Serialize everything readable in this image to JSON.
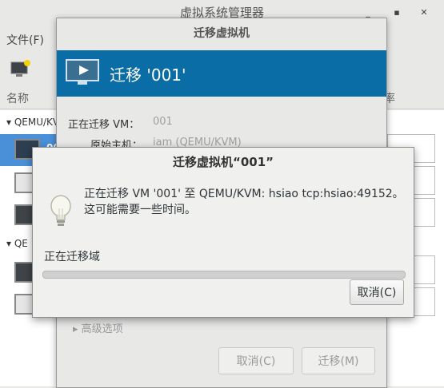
{
  "main_window": {
    "title": "虚拟系统管理器",
    "menu_file": "文件(F)",
    "column_name": "名称",
    "column_rate": "率",
    "group_1": "QEMU/KV",
    "group_2": "QE",
    "selected_vm_name": "00"
  },
  "migrate_dialog": {
    "title": "迁移虚拟机",
    "banner_text": "迁移 '001'",
    "migrating_label": "正在迁移 VM：",
    "migrating_value": "001",
    "origin_label": "原始主机：",
    "origin_value": "iam (QEMU/KVM)",
    "advanced_label": "高级选项",
    "cancel_label": "取消(C)",
    "migrate_label": "迁移(M)"
  },
  "progress_dialog": {
    "title": "迁移虚拟机“001”",
    "message_line1": "正在迁移 VM '001' 至  QEMU/KVM: hsiao tcp:hsiao:49152。",
    "message_line2": "这可能需要一些时间。",
    "status": "正在迁移域",
    "progress": 0,
    "cancel_label": "取消(C)"
  },
  "colors": {
    "banner": "#0b6da5",
    "selection": "#4a90d9"
  },
  "icons": {
    "banner": "monitor-play-icon",
    "hint": "lightbulb-icon"
  }
}
